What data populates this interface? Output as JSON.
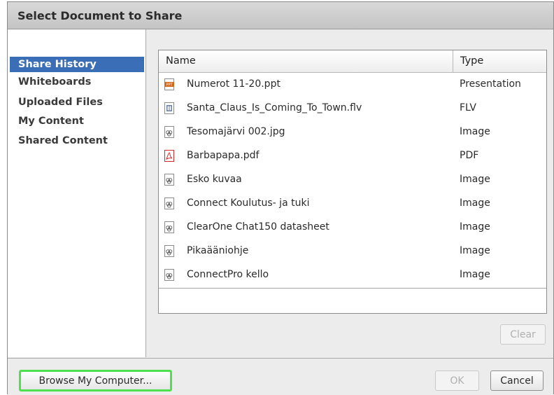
{
  "dialog": {
    "title": "Select Document to Share"
  },
  "sidebar": {
    "items": [
      {
        "label": "Share History",
        "selected": true
      },
      {
        "label": "Whiteboards",
        "selected": false
      },
      {
        "label": "Uploaded Files",
        "selected": false
      },
      {
        "label": "My Content",
        "selected": false
      },
      {
        "label": "Shared Content",
        "selected": false
      }
    ]
  },
  "filelist": {
    "columns": {
      "name": "Name",
      "type": "Type"
    },
    "rows": [
      {
        "name": "Numerot 11-20.ppt",
        "type": "Presentation",
        "icon": "ppt-file-icon"
      },
      {
        "name": "Santa_Claus_Is_Coming_To_Town.flv",
        "type": "FLV",
        "icon": "flv-file-icon"
      },
      {
        "name": "Tesomajärvi 002.jpg",
        "type": "Image",
        "icon": "image-file-icon"
      },
      {
        "name": "Barbapapa.pdf",
        "type": "PDF",
        "icon": "pdf-file-icon"
      },
      {
        "name": "Esko kuvaa",
        "type": "Image",
        "icon": "image-file-icon"
      },
      {
        "name": "Connect Koulutus- ja tuki",
        "type": "Image",
        "icon": "image-file-icon"
      },
      {
        "name": "ClearOne Chat150 datasheet",
        "type": "Image",
        "icon": "image-file-icon"
      },
      {
        "name": "Pikaääniohje",
        "type": "Image",
        "icon": "image-file-icon"
      },
      {
        "name": "ConnectPro kello",
        "type": "Image",
        "icon": "image-file-icon"
      }
    ]
  },
  "buttons": {
    "clear": "Clear",
    "browse": "Browse My Computer...",
    "ok": "OK",
    "cancel": "Cancel"
  },
  "colors": {
    "selection": "#3a6eb6",
    "browse_highlight": "#4fe04f",
    "pdf_red": "#d42a2a",
    "ppt_orange": "#d2691e"
  }
}
